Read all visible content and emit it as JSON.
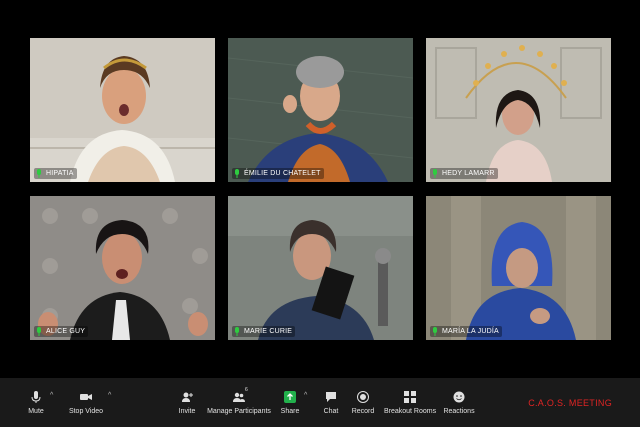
{
  "participants": [
    {
      "name": "HIPATIA"
    },
    {
      "name": "ÉMILIE DU CHATELET"
    },
    {
      "name": "HEDY LAMARR"
    },
    {
      "name": "ALICE GUY"
    },
    {
      "name": "MARIE CURIE"
    },
    {
      "name": "MARÍA LA JUDÍA"
    }
  ],
  "toolbar": {
    "mute_label": "Mute",
    "stop_video_label": "Stop Video",
    "invite_label": "Invite",
    "manage_participants_label": "Manage Participants",
    "participants_count": "6",
    "share_label": "Share",
    "chat_label": "Chat",
    "record_label": "Record",
    "breakout_rooms_label": "Breakout Rooms",
    "reactions_label": "Reactions"
  },
  "meeting_title": "C.A.O.S. MEETING",
  "colors": {
    "background": "#000000",
    "toolbar": "#1a1a1a",
    "mic_active": "#2ecc40",
    "share_green": "#22b14c",
    "meeting_title": "#e02424"
  },
  "icons": [
    "microphone-icon",
    "video-camera-icon",
    "add-person-icon",
    "participants-icon",
    "share-screen-icon",
    "chat-icon",
    "record-icon",
    "breakout-rooms-icon",
    "reactions-icon"
  ]
}
